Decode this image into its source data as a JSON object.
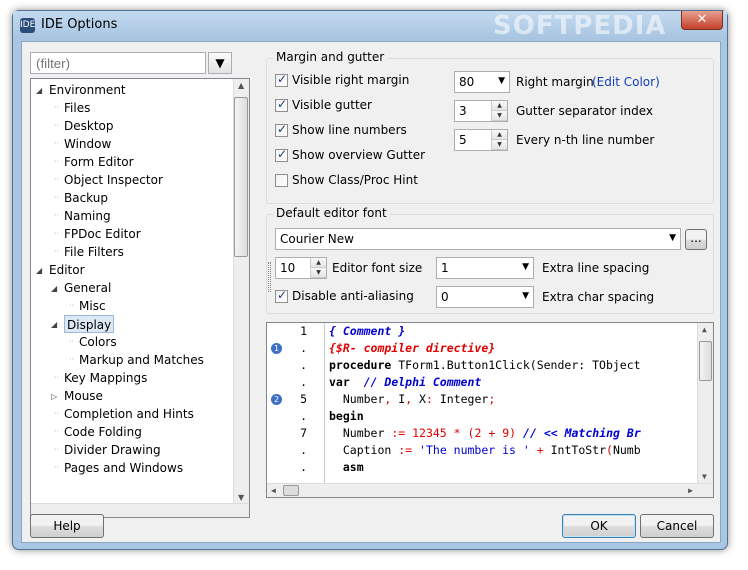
{
  "window": {
    "title": "IDE Options",
    "watermark": "SOFTPEDIA",
    "close_glyph": "✕"
  },
  "filter": {
    "placeholder": "(filter)",
    "icon": "filter-icon"
  },
  "tree": {
    "items": [
      {
        "label": "Environment",
        "level": 0,
        "expanded": true
      },
      {
        "label": "Files",
        "level": 1
      },
      {
        "label": "Desktop",
        "level": 1
      },
      {
        "label": "Window",
        "level": 1
      },
      {
        "label": "Form Editor",
        "level": 1
      },
      {
        "label": "Object Inspector",
        "level": 1
      },
      {
        "label": "Backup",
        "level": 1
      },
      {
        "label": "Naming",
        "level": 1
      },
      {
        "label": "FPDoc Editor",
        "level": 1
      },
      {
        "label": "File Filters",
        "level": 1
      },
      {
        "label": "Editor",
        "level": 0,
        "expanded": true
      },
      {
        "label": "General",
        "level": 1,
        "expanded": true
      },
      {
        "label": "Misc",
        "level": 2
      },
      {
        "label": "Display",
        "level": 1,
        "expanded": true,
        "selected": true
      },
      {
        "label": "Colors",
        "level": 2
      },
      {
        "label": "Markup and Matches",
        "level": 2
      },
      {
        "label": "Key Mappings",
        "level": 1
      },
      {
        "label": "Mouse",
        "level": 1,
        "collapsed": true
      },
      {
        "label": "Completion and Hints",
        "level": 1
      },
      {
        "label": "Code Folding",
        "level": 1
      },
      {
        "label": "Divider Drawing",
        "level": 1
      },
      {
        "label": "Pages and Windows",
        "level": 1
      }
    ]
  },
  "margin_group": {
    "title": "Margin and gutter",
    "visible_right_margin": {
      "label": "Visible right margin",
      "checked": true
    },
    "visible_gutter": {
      "label": "Visible gutter",
      "checked": true
    },
    "show_line_numbers": {
      "label": "Show line numbers",
      "checked": true
    },
    "show_overview_gutter": {
      "label": "Show overview Gutter",
      "checked": true
    },
    "show_class_proc_hint": {
      "label": "Show Class/Proc Hint",
      "checked": false
    },
    "right_margin": {
      "value": "80",
      "label": "Right margin",
      "link": "(Edit Color)"
    },
    "gutter_separator": {
      "value": "3",
      "label": "Gutter separator index"
    },
    "every_nth": {
      "value": "5",
      "label": "Every n-th line number"
    }
  },
  "font_group": {
    "title": "Default editor font",
    "font_name": "Courier New",
    "browse_label": "...",
    "font_size": {
      "value": "10",
      "label": "Editor font size"
    },
    "extra_line_spacing": {
      "value": "1",
      "label": "Extra line spacing"
    },
    "disable_antialiasing": {
      "label": "Disable anti-aliasing",
      "checked": true
    },
    "extra_char_spacing": {
      "value": "0",
      "label": "Extra char spacing"
    }
  },
  "preview": {
    "gutter": [
      "1",
      ".",
      ".",
      ".",
      "5",
      ".",
      "7",
      ".",
      "."
    ],
    "bookmarks": {
      "2": "1",
      "5": "2"
    },
    "lines": [
      "{ Comment }",
      "{$R- compiler directive}",
      "procedure TForm1.Button1Click(Sender: TObject",
      "var  // Delphi Comment",
      "  Number, I, X: Integer;",
      "begin",
      "  Number := 12345 * (2 + 9) // << Matching Br",
      "  Caption := 'The number is ' + IntToStr(Numb",
      "  asm"
    ]
  },
  "buttons": {
    "help": "Help",
    "ok": "OK",
    "cancel": "Cancel"
  },
  "colors": {
    "accent": "#3d70c2",
    "link": "#1040c0",
    "directive": "#e00000"
  }
}
